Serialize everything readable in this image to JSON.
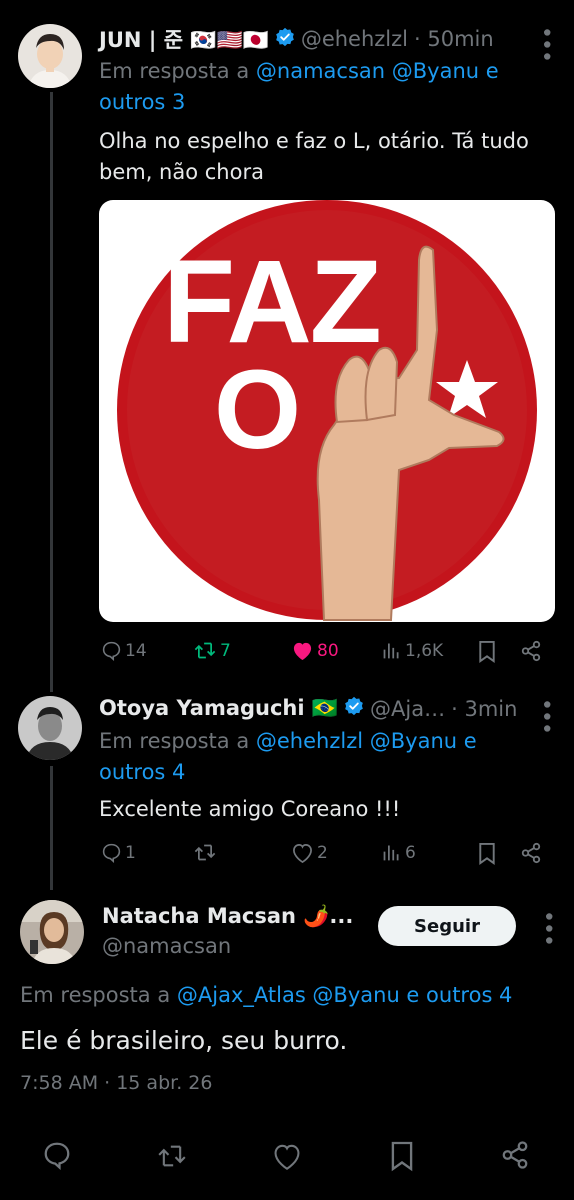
{
  "tweet1": {
    "display_name": "JUN | 준 🇰🇷🇺🇸🇯🇵",
    "handle": "@ehehzlzl",
    "time": "· 50min",
    "reply_prefix": "Em resposta a",
    "reply_mentions": "@namacsan @Byanu e outros 3",
    "text_line1": "Olha no espelho e faz o L, otário. Tá tudo",
    "text_line2": "bem, não chora",
    "image_text_word1": "FAZ",
    "image_text_word2": "O",
    "stats": {
      "replies": "14",
      "retweets": "7",
      "likes": "80",
      "views": "1,6K"
    },
    "colors": {
      "retweet": "#00ba7c",
      "like": "#f91880"
    }
  },
  "tweet2": {
    "display_name": "Otoya Yamaguchi 🇧🇷",
    "handle": "@Aja…",
    "time": "· 3min",
    "reply_prefix": "Em resposta a",
    "reply_mentions": "@ehehzlzl @Byanu e outros 4",
    "text": "Excelente amigo Coreano !!!",
    "stats": {
      "replies": "1",
      "retweets": "",
      "likes": "2",
      "views": "6"
    }
  },
  "main_tweet": {
    "display_name": "Natacha Macsan 🌶️...",
    "handle": "@namacsan",
    "follow_label": "Seguir",
    "reply_prefix": "Em resposta a",
    "reply_mentions": "@Ajax_Atlas @Byanu e outros 4",
    "text": "Ele é brasileiro, seu burro.",
    "timestamp": "7:58 AM · 15 abr. 26"
  },
  "icons": [
    "reply-icon",
    "retweet-icon",
    "like-icon",
    "views-icon",
    "bookmark-icon",
    "share-icon",
    "verified-icon",
    "more-icon"
  ]
}
